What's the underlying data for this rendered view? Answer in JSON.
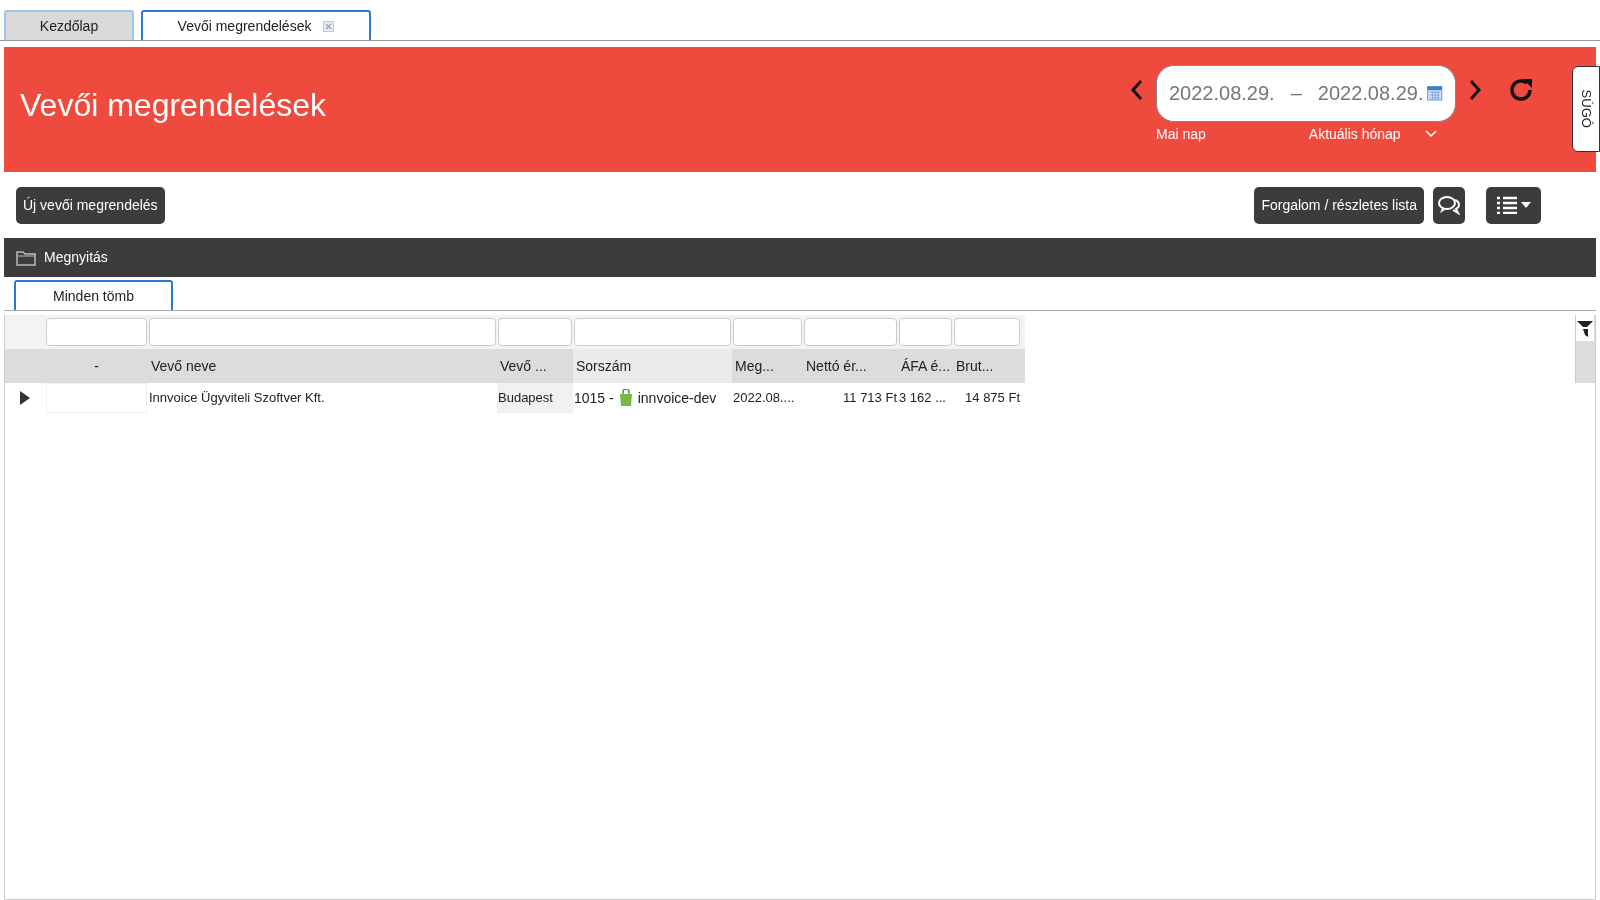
{
  "tabs": [
    {
      "label": "Kezdőlap",
      "selected": false,
      "closable": false
    },
    {
      "label": "Vevői megrendelések",
      "selected": true,
      "closable": true
    }
  ],
  "header": {
    "title": "Vevői megrendelések",
    "date_from": "2022.08.29.",
    "separator": "–",
    "date_to": "2022.08.29.",
    "quick_today": "Mai nap",
    "period": "Aktuális hónap",
    "help": "SÚGÓ"
  },
  "toolbar": {
    "new_button": "Új vevői megrendelés",
    "report_button": "Forgalom / részletes lista"
  },
  "actions": {
    "open": "Megnyitás"
  },
  "subtabs": [
    {
      "label": "Minden tömb",
      "selected": true
    }
  ],
  "table": {
    "columns": [
      "-",
      "Vevő neve",
      "Vevő ...",
      "Sorszám",
      "Meg...",
      "Nettó ér...",
      "ÁFA é...",
      "Brut..."
    ],
    "rows": [
      {
        "expanded": false,
        "cells": [
          {
            "text": ""
          },
          {
            "text": "Innvoice Ügyviteli Szoftver Kft."
          },
          {
            "text": "Budapest"
          },
          {
            "text": "1015 -",
            "kind": "shop",
            "extra": "innvoice-dev"
          },
          {
            "text": "2022.08...."
          },
          {
            "text": "11 713 Ft"
          },
          {
            "text": "3 162 ..."
          },
          {
            "text": "14 875 Ft"
          }
        ]
      }
    ]
  }
}
